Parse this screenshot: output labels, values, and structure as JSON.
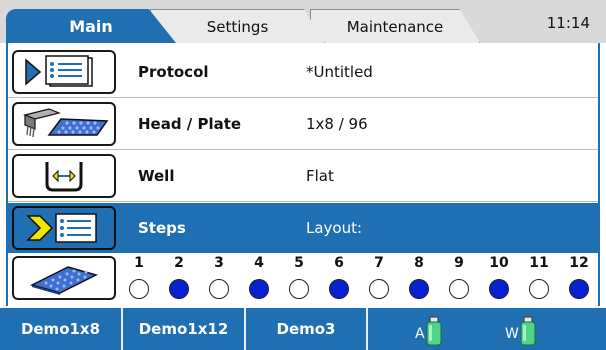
{
  "tabs": [
    {
      "label": "Main",
      "active": true
    },
    {
      "label": "Settings",
      "active": false
    },
    {
      "label": "Maintenance",
      "active": false
    }
  ],
  "clock": "11:14",
  "rows": [
    {
      "label": "Protocol",
      "value": "*Untitled",
      "icon": "protocol-icon"
    },
    {
      "label": "Head / Plate",
      "value": "1x8 / 96",
      "icon": "head-plate-icon"
    },
    {
      "label": "Well",
      "value": "Flat",
      "icon": "well-icon"
    },
    {
      "label": "Steps",
      "value": "Layout:",
      "icon": "steps-icon",
      "selected": true
    }
  ],
  "layout": {
    "icon": "plate-icon",
    "columns": [
      "1",
      "2",
      "3",
      "4",
      "5",
      "6",
      "7",
      "8",
      "9",
      "10",
      "11",
      "12"
    ],
    "filled": [
      false,
      true,
      false,
      true,
      false,
      true,
      false,
      true,
      false,
      true,
      false,
      true
    ]
  },
  "bottom": {
    "buttons": [
      "Demo1x8",
      "Demo1x12",
      "Demo3"
    ],
    "bottles": [
      {
        "letter": "A",
        "icon": "bottle-a-icon"
      },
      {
        "letter": "W",
        "icon": "bottle-w-icon"
      }
    ]
  },
  "colors": {
    "accent": "#1f6fb2",
    "filled_well": "#0a1ed4",
    "bottle": "#4fd38a"
  }
}
